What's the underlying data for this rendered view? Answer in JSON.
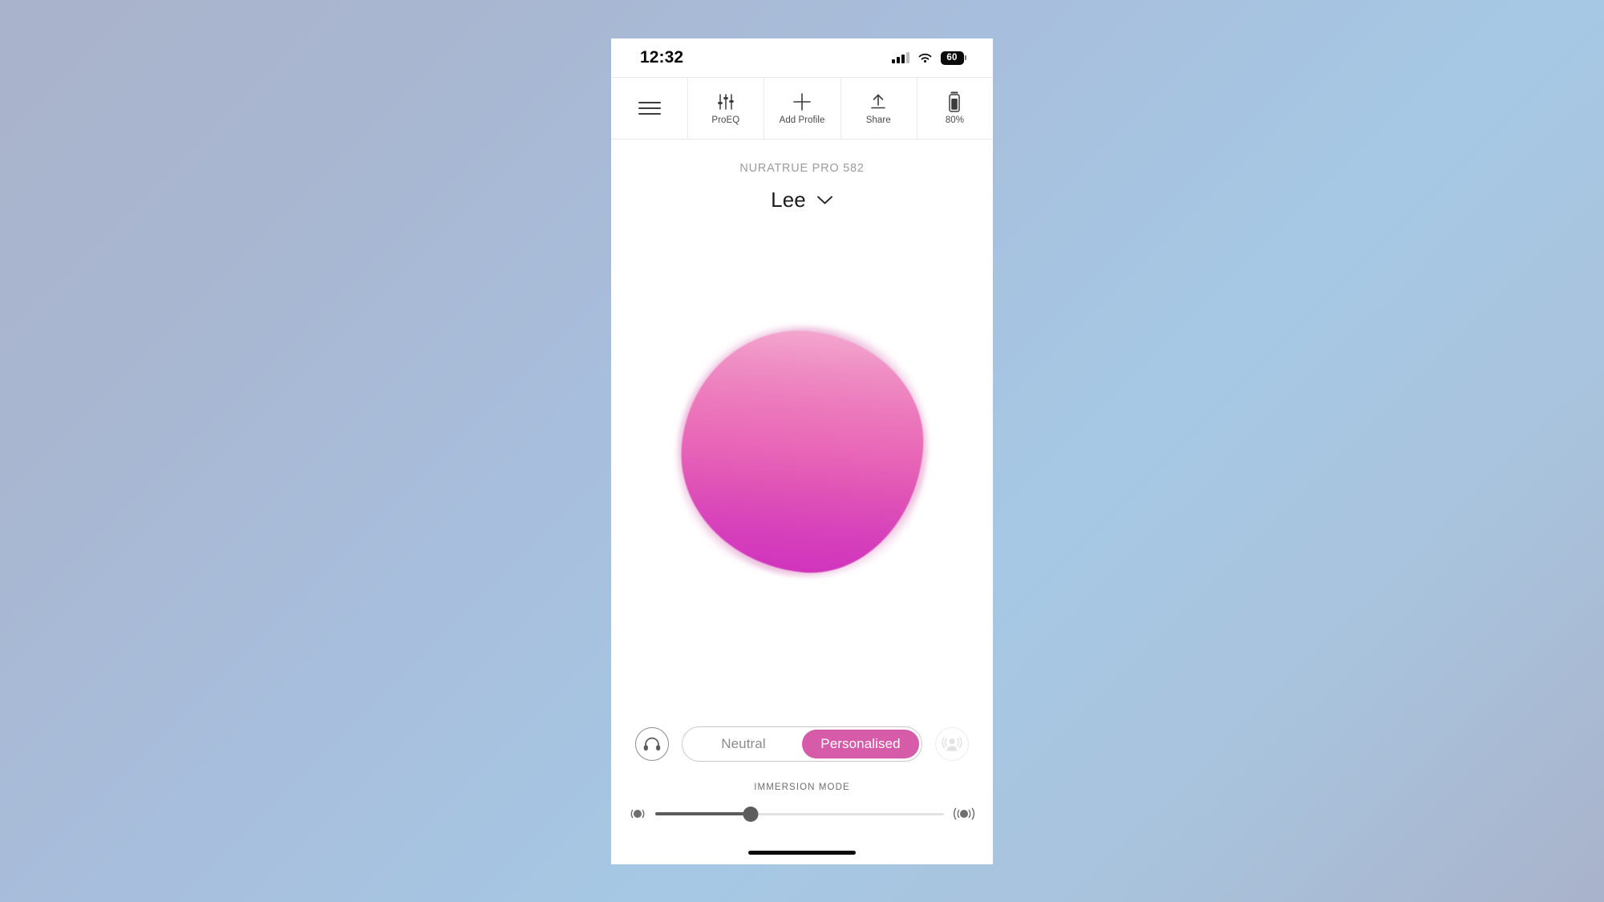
{
  "status_bar": {
    "time": "12:32",
    "signal_icon": "cellular-signal-icon",
    "wifi_icon": "wifi-icon",
    "battery_level": "60",
    "battery_icon": "battery-pill-icon"
  },
  "toolbar": {
    "menu": {
      "icon": "hamburger-menu-icon",
      "label": ""
    },
    "items": [
      {
        "icon": "equalizer-sliders-icon",
        "label": "ProEQ"
      },
      {
        "icon": "plus-icon",
        "label": "Add Profile"
      },
      {
        "icon": "share-upload-icon",
        "label": "Share"
      },
      {
        "icon": "battery-vertical-icon",
        "label": "80%"
      }
    ]
  },
  "device": {
    "name": "NURATRUE PRO 582",
    "profile_name": "Lee",
    "profile_chevron_icon": "chevron-down-icon"
  },
  "hearing_profile_visual": {
    "name": "hearing-profile-blob",
    "gradient_top": "#f4a9cf",
    "gradient_mid": "#e968b8",
    "gradient_bottom": "#cf33bd"
  },
  "mode_row": {
    "left_icon": "headphones-icon",
    "right_icon": "social-mode-icon",
    "right_icon_enabled": false,
    "options": [
      {
        "label": "Neutral",
        "active": false
      },
      {
        "label": "Personalised",
        "active": true
      }
    ],
    "active_color": "#d65ba8"
  },
  "immersion": {
    "title": "IMMERSION MODE",
    "min_icon": "immersion-low-icon",
    "max_icon": "immersion-high-icon",
    "value_percent": 33
  },
  "home_indicator": {
    "name": "home-indicator-bar"
  }
}
